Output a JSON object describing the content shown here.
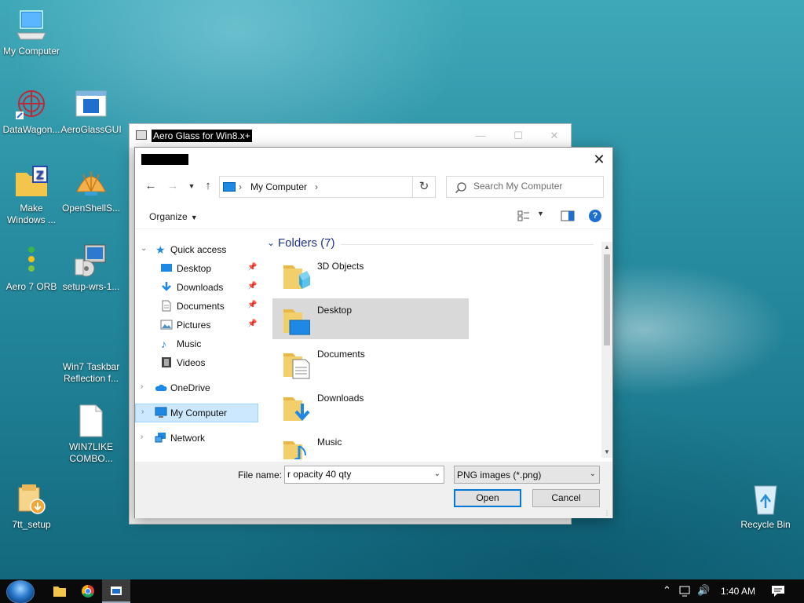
{
  "desktop_icons": [
    {
      "label": "My Computer"
    },
    {
      "label": "DataWagon..."
    },
    {
      "label": "AeroGlassGUI"
    },
    {
      "label": "Make\nWindows ..."
    },
    {
      "label": "OpenShellS..."
    },
    {
      "label": "Aero 7 ORB"
    },
    {
      "label": "setup-wrs-1..."
    },
    {
      "label": "Win7 Taskbar\nReflection f..."
    },
    {
      "label": "WIN7LIKE\nCOMBO..."
    },
    {
      "label": "7tt_setup"
    },
    {
      "label": "Recycle Bin"
    }
  ],
  "bg_window": {
    "title": "Aero Glass for Win8.x+"
  },
  "dialog": {
    "address": {
      "crumb": "My Computer"
    },
    "search": {
      "placeholder": "Search My Computer"
    },
    "toolbar": {
      "organize": "Organize"
    },
    "nav": {
      "quick_access": "Quick access",
      "desktop": "Desktop",
      "downloads": "Downloads",
      "documents": "Documents",
      "pictures": "Pictures",
      "music": "Music",
      "videos": "Videos",
      "onedrive": "OneDrive",
      "my_computer": "My Computer",
      "network": "Network"
    },
    "content": {
      "group_title": "Folders (7)",
      "folders": [
        "3D Objects",
        "Desktop",
        "Documents",
        "Downloads",
        "Music"
      ]
    },
    "file_name_label": "File name:",
    "file_name_value": "r opacity 40 qty",
    "file_type": "PNG images (*.png)",
    "open_label": "Open",
    "cancel_label": "Cancel"
  },
  "taskbar": {
    "clock": "1:40 AM"
  },
  "colors": {
    "accent": "#0078d7",
    "nav_selected": "#cce8ff",
    "group_title": "#1e3287"
  }
}
